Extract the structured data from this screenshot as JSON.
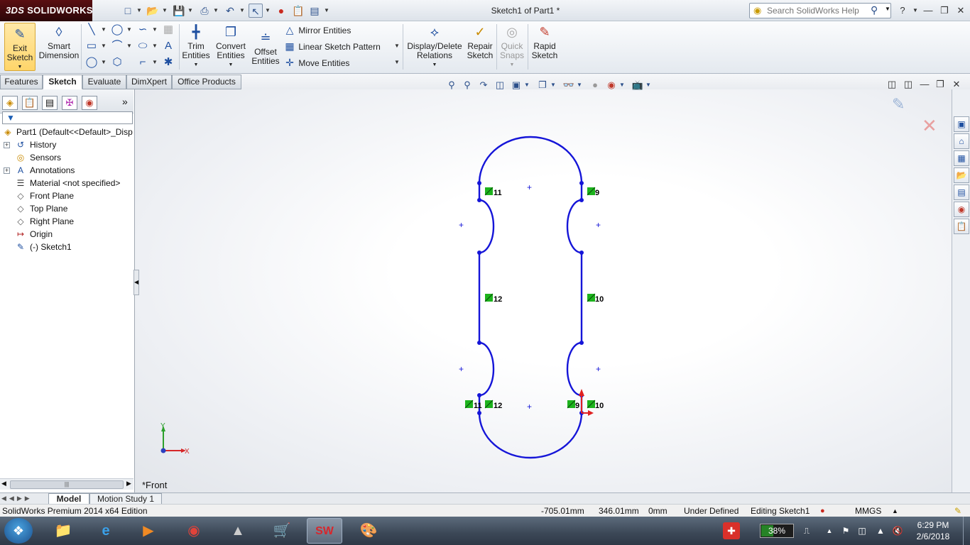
{
  "app": {
    "logo_prefix": "3DS",
    "logo": "SOLIDWORKS",
    "document_title": "Sketch1 of Part1 *",
    "help_search_placeholder": "Search SolidWorks Help"
  },
  "ribbon": {
    "exit_sketch": [
      "Exit",
      "Sketch"
    ],
    "smart_dimension": [
      "Smart",
      "Dimension"
    ],
    "trim_entities": [
      "Trim",
      "Entities"
    ],
    "convert_entities": [
      "Convert",
      "Entities"
    ],
    "offset_entities": [
      "Offset",
      "Entities"
    ],
    "mirror_entities": "Mirror Entities",
    "linear_sketch_pattern": "Linear Sketch Pattern",
    "move_entities": "Move Entities",
    "display_delete_relations": [
      "Display/Delete",
      "Relations"
    ],
    "repair_sketch": [
      "Repair",
      "Sketch"
    ],
    "quick_snaps": [
      "Quick",
      "Snaps"
    ],
    "rapid_sketch": [
      "Rapid",
      "Sketch"
    ]
  },
  "tabs": [
    {
      "label": "Features",
      "active": false
    },
    {
      "label": "Sketch",
      "active": true
    },
    {
      "label": "Evaluate",
      "active": false
    },
    {
      "label": "DimXpert",
      "active": false
    },
    {
      "label": "Office Products",
      "active": false
    }
  ],
  "feature_tree": [
    {
      "label": "Part1  (Default<<Default>_Disp",
      "icon": "part-icon",
      "expandable": false
    },
    {
      "label": "History",
      "icon": "history-icon",
      "expandable": true
    },
    {
      "label": "Sensors",
      "icon": "sensors-icon",
      "expandable": false
    },
    {
      "label": "Annotations",
      "icon": "annotations-icon",
      "expandable": true
    },
    {
      "label": "Material <not specified>",
      "icon": "material-icon",
      "expandable": false
    },
    {
      "label": "Front Plane",
      "icon": "plane-icon",
      "expandable": false
    },
    {
      "label": "Top Plane",
      "icon": "plane-icon",
      "expandable": false
    },
    {
      "label": "Right Plane",
      "icon": "plane-icon",
      "expandable": false
    },
    {
      "label": "Origin",
      "icon": "origin-icon",
      "expandable": false
    },
    {
      "label": "(-) Sketch1",
      "icon": "sketch-icon",
      "expandable": false
    }
  ],
  "sketch": {
    "relation_labels": [
      "11",
      "9",
      "12",
      "10",
      "11",
      "12",
      "9",
      "10"
    ],
    "sketch_color": "#1515d8",
    "relation_color": "#1db31d"
  },
  "triad": {
    "y_label": "Y",
    "x_label": "X"
  },
  "view_name": "*Front",
  "bottom_tabs": [
    {
      "label": "Model",
      "active": true
    },
    {
      "label": "Motion Study 1",
      "active": false
    }
  ],
  "status": {
    "edition": "SolidWorks Premium 2014 x64 Edition",
    "x": "-705.01mm",
    "y": "346.01mm",
    "z": "0mm",
    "state": "Under Defined",
    "mode": "Editing Sketch1",
    "units": "MMGS"
  },
  "taskbar": {
    "battery_percent": 38,
    "battery_label": "38%",
    "time": "6:29 PM",
    "date": "2/6/2018"
  }
}
